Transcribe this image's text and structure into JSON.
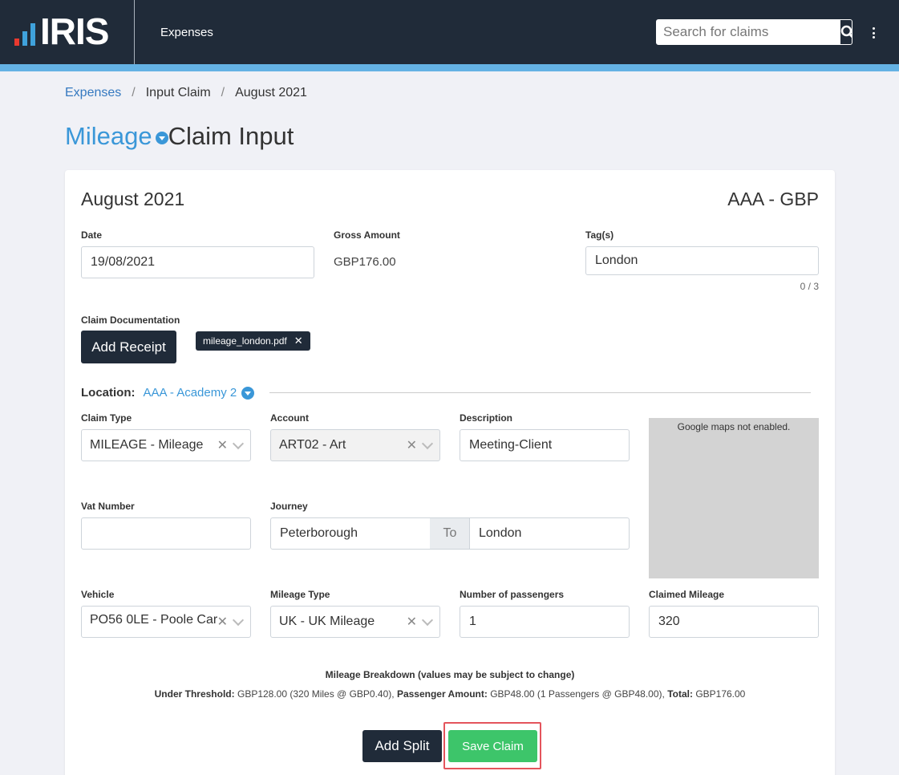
{
  "header": {
    "logo_text": "IRIS",
    "nav_label": "Expenses",
    "search_placeholder": "Search for claims"
  },
  "breadcrumb": [
    "Expenses",
    "Input Claim",
    "August 2021"
  ],
  "page_title": {
    "type": "Mileage",
    "rest": "Claim Input"
  },
  "card": {
    "title": "August 2021",
    "currency": "AAA - GBP",
    "date": {
      "label": "Date",
      "value": "19/08/2021"
    },
    "gross": {
      "label": "Gross Amount",
      "value": "GBP176.00"
    },
    "tags": {
      "label": "Tag(s)",
      "value": "London",
      "counter": "0 / 3"
    },
    "documentation": {
      "label": "Claim Documentation",
      "add_receipt": "Add Receipt",
      "file": "mileage_london.pdf"
    },
    "location": {
      "label": "Location:",
      "value": "AAA - Academy 2"
    },
    "claim_type": {
      "label": "Claim Type",
      "value": "MILEAGE - Mileage"
    },
    "account": {
      "label": "Account",
      "value": "ART02 - Art"
    },
    "description": {
      "label": "Description",
      "value": "Meeting-Client"
    },
    "map_text": "Google maps not enabled.",
    "vat": {
      "label": "Vat Number",
      "value": ""
    },
    "journey": {
      "label": "Journey",
      "from": "Peterborough",
      "to_label": "To",
      "to": "London"
    },
    "vehicle": {
      "label": "Vehicle",
      "value": "PO56 0LE - Poole Car"
    },
    "mileage_type": {
      "label": "Mileage Type",
      "value": "UK - UK Mileage"
    },
    "passengers": {
      "label": "Number of passengers",
      "value": "1"
    },
    "claimed_mileage": {
      "label": "Claimed Mileage",
      "value": "320"
    },
    "breakdown": {
      "title": "Mileage Breakdown (values may be subject to change)",
      "under_label": "Under Threshold:",
      "under_value": "GBP128.00 (320 Miles @ GBP0.40),",
      "passenger_label": "Passenger Amount:",
      "passenger_value": "GBP48.00 (1 Passengers @ GBP48.00),",
      "total_label": "Total:",
      "total_value": "GBP176.00"
    },
    "add_split": "Add Split",
    "save_claim": "Save Claim"
  },
  "colors": {
    "header": "#202b39",
    "accent": "#3a97d8",
    "save": "#3dc56a",
    "highlight": "#e4545c"
  }
}
